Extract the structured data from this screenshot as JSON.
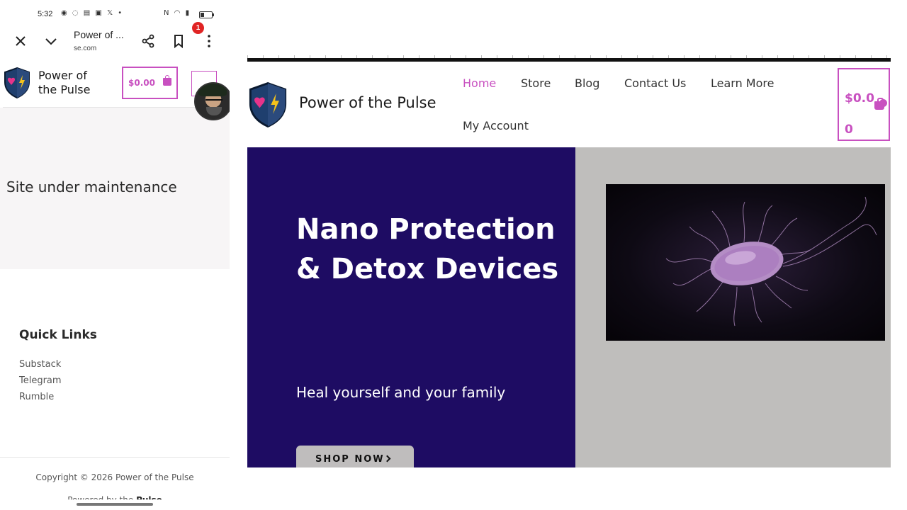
{
  "mobile": {
    "status_bar": {
      "time": "5:32",
      "notification_icons": "◉ ◌ ▤ ▣ 𝕏 •",
      "system_icons": "N ◠ ▮",
      "battery_level": 0.35
    },
    "browser": {
      "title": "Power of ...",
      "url": "se.com",
      "close_icon": "close-icon",
      "minimize_icon": "chevron-down-icon",
      "share_icon": "share-icon",
      "bookmark_icon": "bookmark-icon",
      "menu_icon": "more-vertical-icon"
    },
    "header": {
      "site_name": "Power of the Pulse",
      "cart_total": "$0.00",
      "notification_count": "1"
    },
    "maintenance_text": "Site under maintenance",
    "quick_links": {
      "title": "Quick Links",
      "items": [
        "Substack",
        "Telegram",
        "Rumble"
      ]
    },
    "footer": {
      "copyright": "Copyright © 2026 Power of the Pulse",
      "powered_prefix": "Powered by the",
      "powered_name": "Pulse"
    }
  },
  "desktop": {
    "site_name": "Power of the Pulse",
    "nav": {
      "items": [
        "Home",
        "Store",
        "Blog",
        "Contact Us",
        "Learn More",
        "My Account"
      ],
      "active": "Home"
    },
    "cart_total_line1": "$0.0",
    "cart_total_line2": "0",
    "hero": {
      "title": "Nano Protection & Detox Devices",
      "subtitle": "Heal yourself and your family",
      "cta": "SHOP NOW"
    }
  },
  "colors": {
    "accent": "#c850c0",
    "hero_bg": "#1e0c63",
    "hero_image_bg": "#bfbebc",
    "shield_blue": "#1f3f6e",
    "heart_pink": "#e8338a",
    "bolt_yellow": "#f5c21b"
  }
}
